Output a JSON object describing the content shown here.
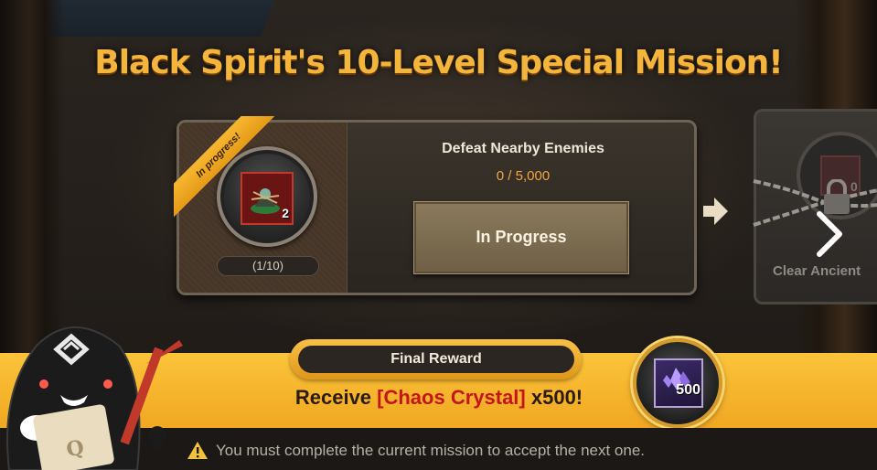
{
  "title": "Black Spirit's 10-Level Special Mission!",
  "current_mission": {
    "status_ribbon": "In progress!",
    "item_quantity": "2",
    "step": "(1/10)",
    "name": "Defeat Nearby Enemies",
    "count": "0 / 5,000",
    "button_label": "In Progress",
    "icon": "item-icon"
  },
  "next_mission": {
    "name_partial": "Clear Ancient",
    "item_quantity": "0",
    "locked": true,
    "icons": [
      "chain-icon",
      "lock-icon"
    ]
  },
  "reward": {
    "header": "Final Reward",
    "text_prefix": "Receive ",
    "item_name": "[Chaos Crystal]",
    "text_suffix": " x500!",
    "quantity_badge": "500",
    "icon": "chaos-crystal-icon"
  },
  "notice": {
    "text": "You must complete the current mission to accept the next one.",
    "icon": "warning-icon"
  },
  "colors": {
    "title": "#f3b53c",
    "ribbon": "#f1a722",
    "banner": "#fbc43a",
    "highlight": "#c4151c",
    "count": "#f3a640"
  }
}
